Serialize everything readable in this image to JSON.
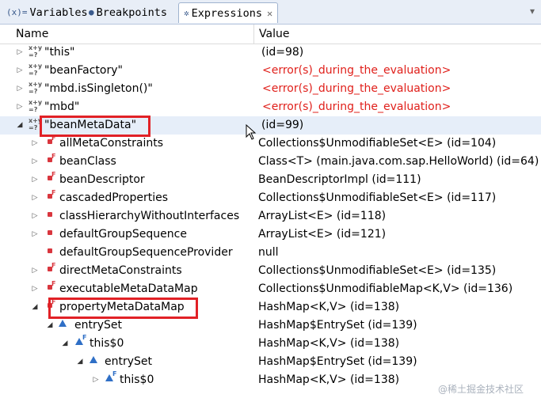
{
  "tabs": [
    {
      "label": "Variables",
      "icon": "(x)="
    },
    {
      "label": "Breakpoints",
      "icon": "●"
    },
    {
      "label": "Expressions",
      "icon": "✲"
    }
  ],
  "tab_close": "✕",
  "toolbar": {
    "menu_icon": "▾"
  },
  "columns": {
    "name": "Name",
    "value": "Value"
  },
  "expressions": [
    {
      "name": "\"this\"",
      "value": "(id=98)"
    },
    {
      "name": "\"beanFactory\"",
      "value": "<error(s)_during_the_evaluation>"
    },
    {
      "name": "\"mbd.isSingleton()\"",
      "value": "<error(s)_during_the_evaluation>"
    },
    {
      "name": "\"mbd\"",
      "value": "<error(s)_during_the_evaluation>"
    },
    {
      "name": "\"beanMetaData\"",
      "value": "(id=99)"
    }
  ],
  "fields": [
    {
      "name": "allMetaConstraints",
      "value": "Collections$UnmodifiableSet<E>  (id=104)"
    },
    {
      "name": "beanClass",
      "value": "Class<T> (main.java.com.sap.HelloWorld) (id=64)"
    },
    {
      "name": "beanDescriptor",
      "value": "BeanDescriptorImpl  (id=111)"
    },
    {
      "name": "cascadedProperties",
      "value": "Collections$UnmodifiableSet<E>  (id=117)"
    },
    {
      "name": "classHierarchyWithoutInterfaces",
      "value": "ArrayList<E>  (id=118)"
    },
    {
      "name": "defaultGroupSequence",
      "value": "ArrayList<E>  (id=121)"
    },
    {
      "name": "defaultGroupSequenceProvider",
      "value": "null"
    },
    {
      "name": "directMetaConstraints",
      "value": "Collections$UnmodifiableSet<E>  (id=135)"
    },
    {
      "name": "executableMetaDataMap",
      "value": "Collections$UnmodifiableMap<K,V>  (id=136)"
    },
    {
      "name": "propertyMetaDataMap",
      "value": "HashMap<K,V>  (id=138)"
    },
    {
      "name": "entrySet",
      "value": "HashMap$EntrySet  (id=139)"
    },
    {
      "name": "this$0",
      "value": "HashMap<K,V>  (id=138)"
    },
    {
      "name": "entrySet",
      "value": "HashMap$EntrySet  (id=139)"
    },
    {
      "name": "this$0",
      "value": "HashMap<K,V>  (id=138)"
    }
  ],
  "watermark": "@稀土掘金技术社区",
  "colors": {
    "error": "#e0201b",
    "highlight": "#e12126",
    "tabbar": "#e8eef7"
  }
}
